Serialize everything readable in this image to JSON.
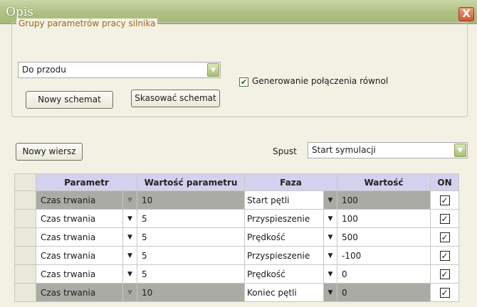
{
  "window": {
    "title": "Opis",
    "close_label": "X"
  },
  "group": {
    "legend": "Grupy parametrów pracy silnika",
    "direction_value": "Do przodu",
    "generate_label": "Generowanie połączenia równol",
    "generate_checked": true,
    "new_scheme_label": "Nowy schemat",
    "delete_scheme_label": "Skasować schemat"
  },
  "toolbar": {
    "new_row_label": "Nowy wiersz",
    "trigger_label": "Spust",
    "trigger_value": "Start symulacji"
  },
  "grid": {
    "headers": [
      "Parametr",
      "Wartość parametru",
      "Faza",
      "Wartość",
      "ON"
    ],
    "rows": [
      {
        "param": "Czas trwania",
        "param_value": "10",
        "phase": "Start pętli",
        "value": "100",
        "on": true,
        "selected": true
      },
      {
        "param": "Czas trwania",
        "param_value": "5",
        "phase": "Przyspieszenie",
        "value": "100",
        "on": true,
        "selected": false
      },
      {
        "param": "Czas trwania",
        "param_value": "5",
        "phase": "Prędkość",
        "value": "500",
        "on": true,
        "selected": false
      },
      {
        "param": "Czas trwania",
        "param_value": "5",
        "phase": "Przyspieszenie",
        "value": "-100",
        "on": true,
        "selected": false
      },
      {
        "param": "Czas trwania",
        "param_value": "5",
        "phase": "Prędkość",
        "value": "0",
        "on": true,
        "selected": false
      },
      {
        "param": "Czas trwania",
        "param_value": "10",
        "phase": "Koniec pętli",
        "value": "0",
        "on": true,
        "selected": true
      }
    ]
  },
  "icons": {
    "dropdown": "chevron-down-icon",
    "check": "check-icon"
  }
}
